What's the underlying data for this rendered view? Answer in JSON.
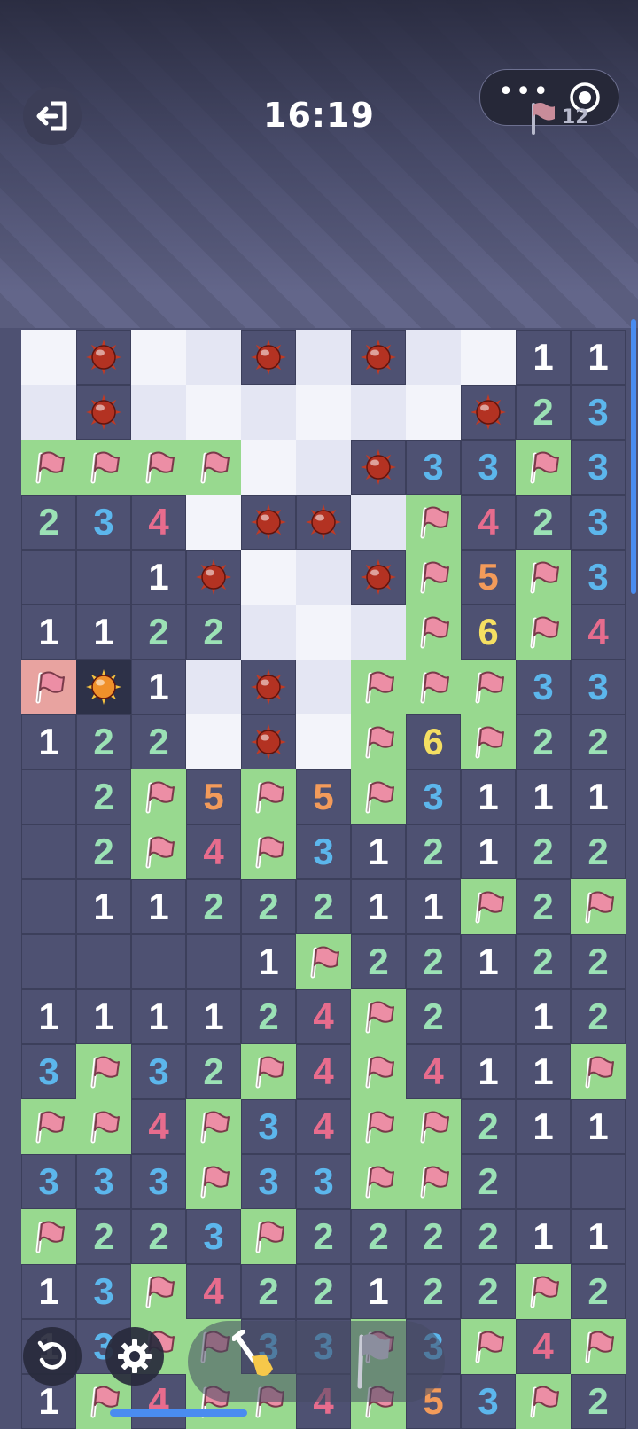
{
  "header": {
    "timer": "16:19",
    "exit_icon": "exit-icon",
    "menu_icon": "more-dots-icon",
    "target_icon": "target-icon",
    "flag_count": "12"
  },
  "colors": {
    "board": "#4e5172",
    "covered_light": "#f3f4fa",
    "covered_alt": "#e4e6f3",
    "revealed": "#4e5172",
    "flagged": "#98d98f",
    "wrong": "#e8a3a0",
    "exploded": "#2d3148",
    "n1": "#ffffff",
    "n2": "#9be1b5",
    "n3": "#5cb6ec",
    "n4": "#e76c8d",
    "n5": "#f39b5a",
    "n6": "#f5df62"
  },
  "legend": {
    "W": "covered",
    "M": "mine",
    "F": "flag",
    "E": "empty",
    "R": "wrong-flag",
    "X": "exploded-mine"
  },
  "board": {
    "rows": [
      [
        "W",
        "M",
        "W",
        "W",
        "M",
        "W",
        "M",
        "W",
        "W",
        "1",
        "1"
      ],
      [
        "W",
        "M",
        "W",
        "W",
        "W",
        "W",
        "W",
        "W",
        "M",
        "2",
        "3"
      ],
      [
        "F",
        "F",
        "F",
        "F",
        "W",
        "W",
        "M",
        "3",
        "3",
        "F",
        "3"
      ],
      [
        "2",
        "3",
        "4",
        "W",
        "M",
        "M",
        "W",
        "F",
        "4",
        "2",
        "3"
      ],
      [
        "E",
        "E",
        "1",
        "M",
        "W",
        "W",
        "M",
        "F",
        "5",
        "F",
        "3"
      ],
      [
        "1",
        "1",
        "2",
        "2",
        "W",
        "W",
        "W",
        "F",
        "6",
        "F",
        "4"
      ],
      [
        "R",
        "X",
        "1",
        "W",
        "M",
        "W",
        "F",
        "F",
        "F",
        "3",
        "3"
      ],
      [
        "1",
        "2",
        "2",
        "W",
        "M",
        "W",
        "F",
        "6",
        "F",
        "2",
        "2"
      ],
      [
        "E",
        "2",
        "F",
        "5",
        "F",
        "5",
        "F",
        "3",
        "1",
        "1",
        "1"
      ],
      [
        "E",
        "2",
        "F",
        "4",
        "F",
        "3",
        "1",
        "2",
        "1",
        "2",
        "2"
      ],
      [
        "E",
        "1",
        "1",
        "2",
        "2",
        "2",
        "1",
        "1",
        "F",
        "2",
        "F"
      ],
      [
        "E",
        "E",
        "E",
        "E",
        "1",
        "F",
        "2",
        "2",
        "1",
        "2",
        "2"
      ],
      [
        "1",
        "1",
        "1",
        "1",
        "2",
        "4",
        "F",
        "2",
        "E",
        "1",
        "2"
      ],
      [
        "3",
        "F",
        "3",
        "2",
        "F",
        "4",
        "F",
        "4",
        "1",
        "1",
        "F"
      ],
      [
        "F",
        "F",
        "4",
        "F",
        "3",
        "4",
        "F",
        "F",
        "2",
        "1",
        "1"
      ],
      [
        "3",
        "3",
        "3",
        "F",
        "3",
        "3",
        "F",
        "F",
        "2",
        "E",
        "E"
      ],
      [
        "F",
        "2",
        "2",
        "3",
        "F",
        "2",
        "2",
        "2",
        "2",
        "1",
        "1"
      ],
      [
        "1",
        "3",
        "F",
        "4",
        "2",
        "2",
        "1",
        "2",
        "2",
        "F",
        "2"
      ],
      [
        "1",
        "3",
        "F",
        "F",
        "3",
        "3",
        "F",
        "3",
        "F",
        "4",
        "F"
      ],
      [
        "1",
        "F",
        "4",
        "F",
        "F",
        "4",
        "F",
        "5",
        "3",
        "F",
        "2"
      ]
    ]
  },
  "toolbar": {
    "restart_icon": "restart-icon",
    "settings_icon": "gear-icon",
    "dig_icon": "shovel-icon",
    "flag_icon": "flag-tool-icon"
  }
}
